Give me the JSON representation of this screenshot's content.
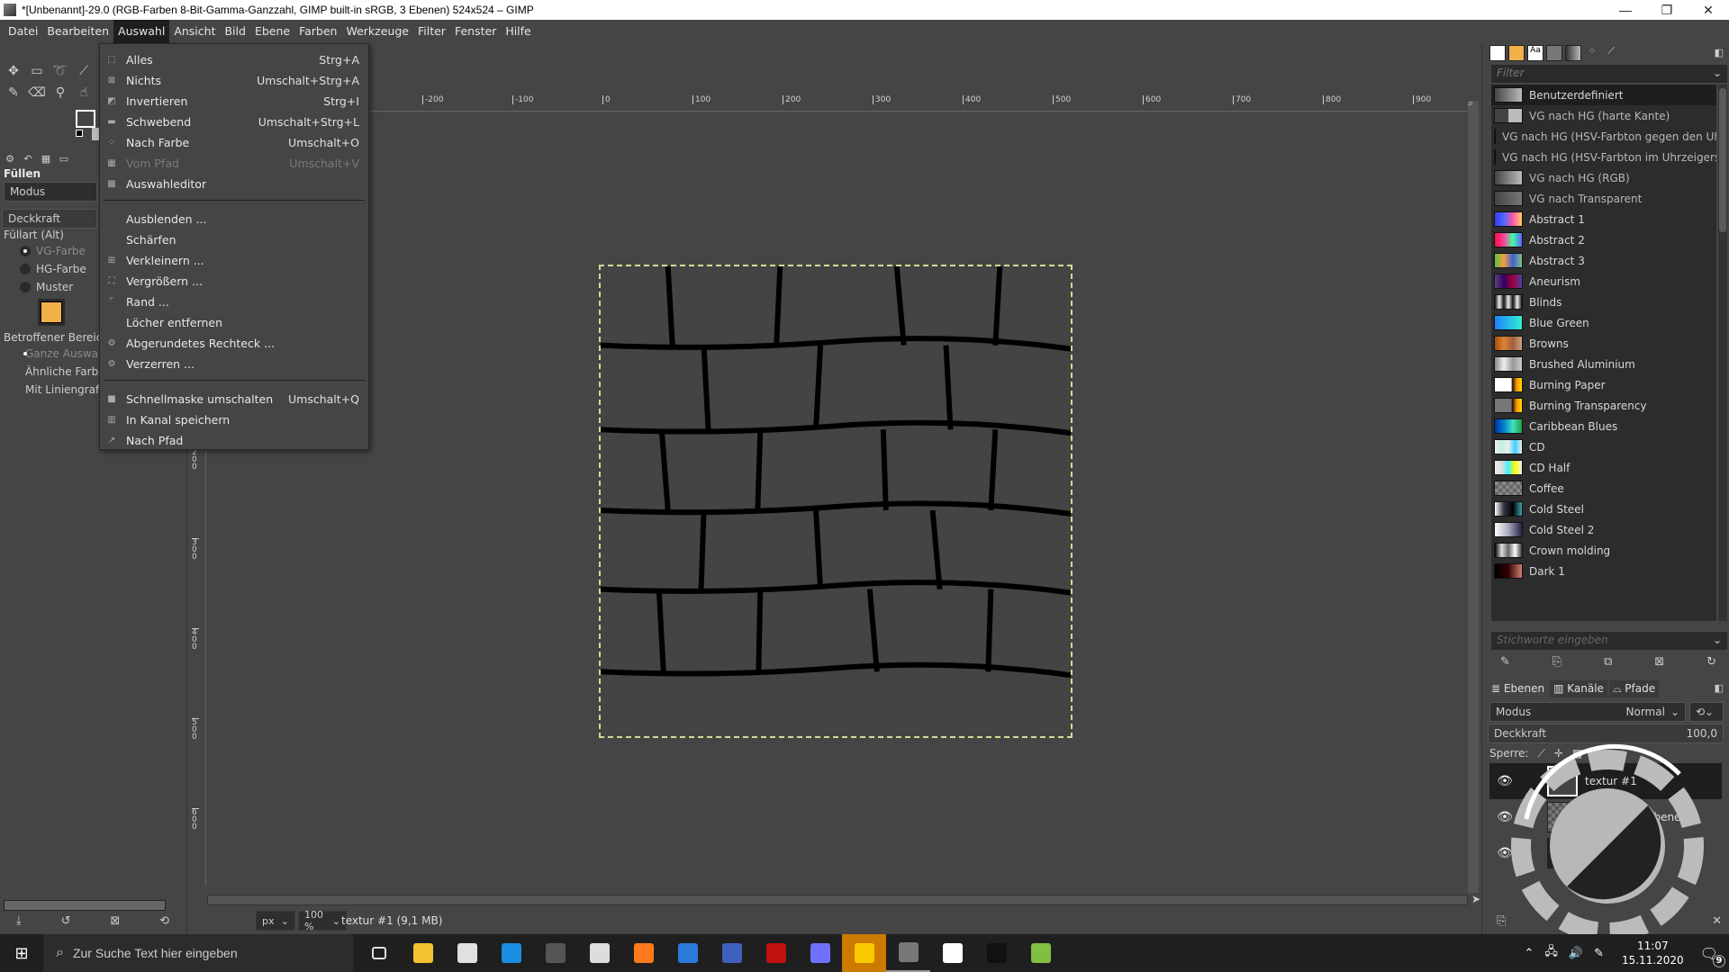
{
  "window": {
    "title": "*[Unbenannt]-29.0 (RGB-Farben 8-Bit-Gamma-Ganzzahl, GIMP built-in sRGB, 3 Ebenen) 524x524 – GIMP",
    "minimize": "—",
    "maximize": "❐",
    "close": "✕"
  },
  "menubar": [
    "Datei",
    "Bearbeiten",
    "Auswahl",
    "Ansicht",
    "Bild",
    "Ebene",
    "Farben",
    "Werkzeuge",
    "Filter",
    "Fenster",
    "Hilfe"
  ],
  "active_menu": "Auswahl",
  "select_menu": {
    "items": [
      {
        "label": "Alles",
        "shortcut": "Strg+A",
        "icon": "select-all-icon",
        "glyph": "⬚"
      },
      {
        "label": "Nichts",
        "shortcut": "Umschalt+Strg+A",
        "icon": "select-none-icon",
        "glyph": "⊠"
      },
      {
        "label": "Invertieren",
        "shortcut": "Strg+I",
        "icon": "invert-selection-icon",
        "glyph": "◩"
      },
      {
        "label": "Schwebend",
        "shortcut": "Umschalt+Strg+L",
        "icon": "float-icon",
        "glyph": "▬"
      },
      {
        "label": "Nach Farbe",
        "shortcut": "Umschalt+O",
        "icon": "select-by-color-icon",
        "glyph": "⁘"
      },
      {
        "label": "Vom Pfad",
        "shortcut": "Umschalt+V",
        "icon": "from-path-icon",
        "glyph": "▦",
        "disabled": true
      },
      {
        "label": "Auswahleditor",
        "shortcut": "",
        "icon": "selection-editor-icon",
        "glyph": "▩"
      },
      {
        "label": "Ausblenden ...",
        "shortcut": "",
        "icon": "",
        "glyph": ""
      },
      {
        "label": "Schärfen",
        "shortcut": "",
        "icon": "",
        "glyph": ""
      },
      {
        "label": "Verkleinern ...",
        "shortcut": "",
        "icon": "shrink-icon",
        "glyph": "⊞"
      },
      {
        "label": "Vergrößern ...",
        "shortcut": "",
        "icon": "grow-icon",
        "glyph": "⛶"
      },
      {
        "label": "Rand ...",
        "shortcut": "",
        "icon": "border-icon",
        "glyph": "⌜"
      },
      {
        "label": "Löcher entfernen",
        "shortcut": "",
        "icon": "",
        "glyph": ""
      },
      {
        "label": "Abgerundetes Rechteck ...",
        "shortcut": "",
        "icon": "script-fu-icon",
        "glyph": "⚙"
      },
      {
        "label": "Verzerren ...",
        "shortcut": "",
        "icon": "script-fu-icon",
        "glyph": "⚙"
      },
      {
        "label": "Schnellmaske umschalten",
        "shortcut": "Umschalt+Q",
        "icon": "quickmask-icon",
        "glyph": "■"
      },
      {
        "label": "In Kanal speichern",
        "shortcut": "",
        "icon": "save-to-channel-icon",
        "glyph": "▥"
      },
      {
        "label": "Nach Pfad",
        "shortcut": "",
        "icon": "to-path-icon",
        "glyph": "↗"
      }
    ]
  },
  "tool_options": {
    "title": "Füllen",
    "mode_label": "Modus",
    "opacity_label": "Deckkraft",
    "fill_type_label": "Füllart  (Alt)",
    "fill_types": [
      "VG-Farbe",
      "HG-Farbe",
      "Muster"
    ],
    "fill_type_selected": "VG-Farbe",
    "affected_label": "Betroffener Bereich",
    "affected_options": [
      "Ganze Auswahl füllen",
      "Ähnliche Farben füllen",
      "Mit Liniengrafik füllen"
    ],
    "affected_selected": "Ganze Auswahl füllen",
    "pattern_color": "#f2b04a"
  },
  "rulers": {
    "horizontal": [
      "-200",
      "-100",
      "0",
      "100",
      "200",
      "300",
      "400",
      "500",
      "600",
      "700",
      "800",
      "900"
    ],
    "vertical": [
      "200",
      "300",
      "400",
      "500",
      "600"
    ]
  },
  "statusbar": {
    "unit": "px",
    "zoom": "100 %",
    "info": "textur #1 (9,1 MB)"
  },
  "gradients": {
    "filter_placeholder": "Filter",
    "tags_placeholder": "Stichworte eingeben",
    "items": [
      {
        "name": "Benutzerdefiniert",
        "swatch": "linear-gradient(90deg,#444,#bbb)",
        "selected": true
      },
      {
        "name": "VG nach HG (harte Kante)",
        "swatch": "linear-gradient(90deg,#444 50%,#bbb 50%)"
      },
      {
        "name": "VG nach HG (HSV-Farbton gegen den Uhrzeigersinn)",
        "swatch": "linear-gradient(90deg,#444,#bbb)"
      },
      {
        "name": "VG nach HG (HSV-Farbton im Uhrzeigersinn)",
        "swatch": "linear-gradient(90deg,#444,#bbb)"
      },
      {
        "name": "VG nach HG (RGB)",
        "swatch": "linear-gradient(90deg,#444,#bbb)"
      },
      {
        "name": "VG nach Transparent",
        "swatch": "linear-gradient(90deg,#444,#777)"
      },
      {
        "name": "Abstract 1",
        "swatch": "linear-gradient(90deg,#3a3aff,#4a6aff,#ff55aa,#ffd060)"
      },
      {
        "name": "Abstract 2",
        "swatch": "linear-gradient(90deg,#ff1040,#ff40a0,#40ffa0,#6060ff)"
      },
      {
        "name": "Abstract 3",
        "swatch": "linear-gradient(90deg,#60c040,#f0a040,#4060d0,#80c080)"
      },
      {
        "name": "Aneurism",
        "swatch": "linear-gradient(90deg,#604080,#300060,#a00040,#5040a0)"
      },
      {
        "name": "Blinds",
        "swatch": "repeating-linear-gradient(90deg,#111 0,#eee 5px,#111 10px)"
      },
      {
        "name": "Blue Green",
        "swatch": "linear-gradient(90deg,#2080ff,#30f0d0)"
      },
      {
        "name": "Browns",
        "swatch": "linear-gradient(90deg,#a05010,#e08030,#a06040,#d0a080)"
      },
      {
        "name": "Brushed Aluminium",
        "swatch": "linear-gradient(90deg,#888,#eee,#999,#ccc)"
      },
      {
        "name": "Burning Paper",
        "swatch": "linear-gradient(90deg,#fff 60%,#111 65%,#ff9000 80%,#ffe000)"
      },
      {
        "name": "Burning Transparency",
        "swatch": "linear-gradient(90deg,#777 60%,#111 65%,#ff9000 80%,#ffe000)"
      },
      {
        "name": "Caribbean Blues",
        "swatch": "linear-gradient(90deg,#0030a0,#0080d0,#40e0c0,#20a040)"
      },
      {
        "name": "CD",
        "swatch": "linear-gradient(90deg,#eee,#c0f0e0,#eee,#40d0ff,#eee)"
      },
      {
        "name": "CD Half",
        "swatch": "linear-gradient(90deg,#eee,#ddd,#40f0ff,#ff0,#eee)"
      },
      {
        "name": "Coffee",
        "swatch": "repeating-conic-gradient(#666 0 25%,#888 0 50%) 0 0/8px 8px"
      },
      {
        "name": "Cold Steel",
        "swatch": "linear-gradient(90deg,#fff,#334,#000,#40a0b0)"
      },
      {
        "name": "Cold Steel 2",
        "swatch": "linear-gradient(90deg,#fff,#aab,#224)"
      },
      {
        "name": "Crown molding",
        "swatch": "linear-gradient(90deg,#000,#ddd,#666,#fff,#333)"
      },
      {
        "name": "Dark 1",
        "swatch": "linear-gradient(90deg,#000,#300,#d08070)"
      }
    ]
  },
  "layers_panel": {
    "tabs": [
      "Ebenen",
      "Kanäle",
      "Pfade"
    ],
    "mode_label": "Modus",
    "mode_value": "Normal",
    "opacity_label": "Deckkraft",
    "opacity_value": "100,0",
    "lock_label": "Sperre:",
    "layers": [
      {
        "name": "textur #1",
        "visible": true,
        "selected": true
      },
      {
        "name": "Eingefügte Ebene",
        "visible": true,
        "selected": false
      },
      {
        "name": "",
        "visible": true,
        "selected": false
      }
    ]
  },
  "taskbar": {
    "search_placeholder": "Zur Suche Text hier eingeben",
    "apps": [
      {
        "name": "task-view",
        "color": "#1f1f1f"
      },
      {
        "name": "file-explorer",
        "color": "#f2c230"
      },
      {
        "name": "store",
        "color": "#e0e0e0"
      },
      {
        "name": "mail",
        "color": "#1a8ee0"
      },
      {
        "name": "gimp-small",
        "color": "#555"
      },
      {
        "name": "app-grid",
        "color": "#ddd"
      },
      {
        "name": "firefox",
        "color": "#ff7a1a"
      },
      {
        "name": "vnc",
        "color": "#2a7ad8"
      },
      {
        "name": "network",
        "color": "#4060c0"
      },
      {
        "name": "filezilla",
        "color": "#c01010"
      },
      {
        "name": "browser-round",
        "color": "#7070ff"
      },
      {
        "name": "sticky-notes",
        "color": "#f8c800",
        "active": true
      },
      {
        "name": "gimp",
        "color": "#777",
        "running": true
      },
      {
        "name": "audible",
        "color": "#fff"
      },
      {
        "name": "terminal",
        "color": "#111"
      },
      {
        "name": "notepad",
        "color": "#80c040"
      }
    ],
    "time": "11:07",
    "date": "15.11.2020",
    "notifications": "9"
  }
}
